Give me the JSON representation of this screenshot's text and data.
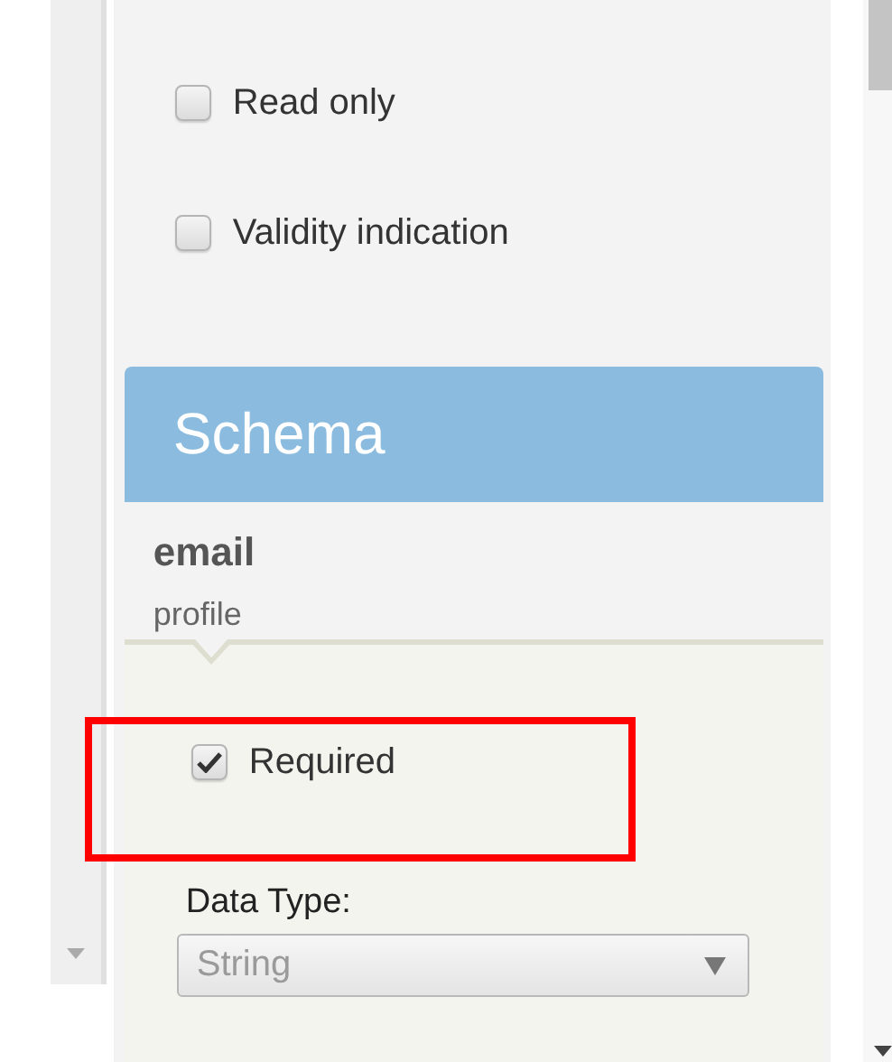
{
  "options": [
    {
      "label": "Read only",
      "checked": false
    },
    {
      "label": "Validity indication",
      "checked": false
    }
  ],
  "schema": {
    "title": "Schema",
    "field_name": "email",
    "group": "profile",
    "required": {
      "label": "Required",
      "checked": true
    },
    "data_type": {
      "label": "Data Type:",
      "value": "String",
      "disabled": true
    }
  },
  "highlight_required": true
}
